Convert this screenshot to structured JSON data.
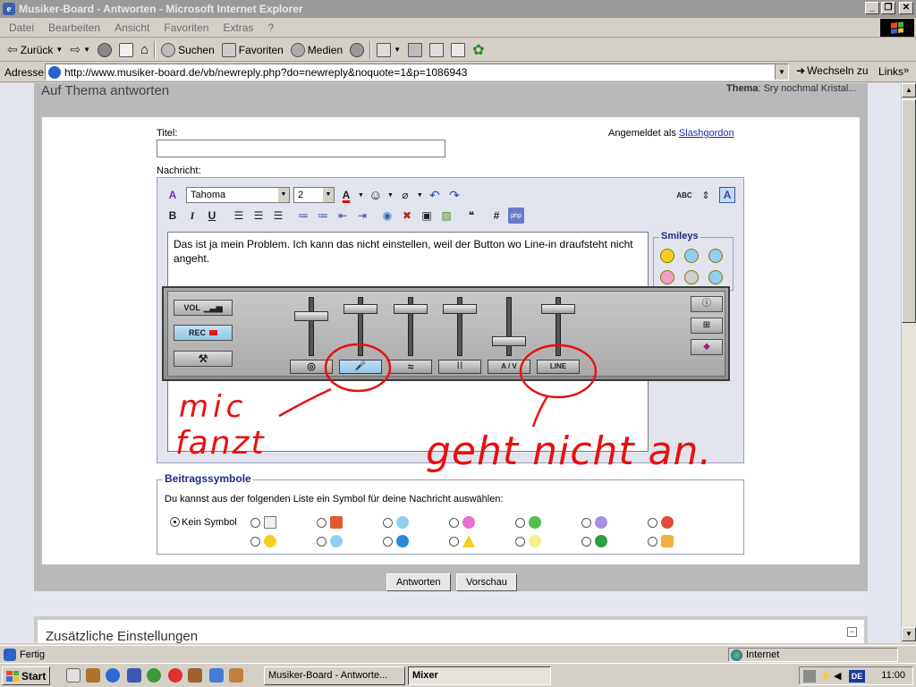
{
  "window": {
    "title": "Musiker-Board - Antworten - Microsoft Internet Explorer",
    "buttons": {
      "minimize": "_",
      "maximize": "❐",
      "close": "✕"
    }
  },
  "menu": [
    "Datei",
    "Bearbeiten",
    "Ansicht",
    "Favoriten",
    "Extras",
    "?"
  ],
  "toolbar": {
    "back": "Zurück",
    "search": "Suchen",
    "favorites": "Favoriten",
    "media": "Medien"
  },
  "address": {
    "label": "Adresse",
    "url": "http://www.musiker-board.de/vb/newreply.php?do=newreply&noquote=1&p=1086943",
    "go": "Wechseln zu",
    "links": "Links"
  },
  "page": {
    "heading": "Auf Thema antworten",
    "thema_label": "Thema",
    "thema_value": ": Sry nochmal Kristal...",
    "title_label": "Titel:",
    "logged_in_prefix": "Angemeldet als ",
    "logged_in_user": "Slashgordon",
    "message_label": "Nachricht:",
    "editor": {
      "font": "Tahoma",
      "size": "2",
      "bold": "B",
      "italic": "I",
      "underline": "U",
      "hash": "#",
      "php": "php",
      "spell": "ABC"
    },
    "message_text": "Das ist ja mein Problem. Ich kann das nicht einstellen, weil der Button wo Line-in draufsteht nicht angeht.",
    "smileys_label": "Smileys",
    "beitragssymbole_label": "Beitragssymbole",
    "beitragssymbole_desc": "Du kannst aus der folgenden Liste ein Symbol für deine Nachricht auswählen:",
    "kein_symbol": "Kein Symbol",
    "submit_button": "Antworten",
    "preview_button": "Vorschau",
    "extra_settings": "Zusätzliche Einstellungen",
    "collapse": "−"
  },
  "mixer": {
    "vol": "VOL",
    "rec": "REC",
    "channels": [
      "◎",
      "🎤",
      "≈",
      "⁞⁞",
      "A / V",
      "LINE"
    ],
    "fader_levels": [
      0.3,
      0.15,
      0.15,
      0.15,
      0.85,
      0.15
    ]
  },
  "annotations": {
    "mic": "mic",
    "fanzt": "fanzt",
    "geht_nicht_an": "geht nicht an."
  },
  "status": {
    "left": "Fertig",
    "zone": "Internet"
  },
  "taskbar": {
    "start": "Start",
    "tasks": [
      "Musiker-Board - Antworte...",
      "Mixer"
    ],
    "lang": "DE",
    "clock": "11:00"
  }
}
